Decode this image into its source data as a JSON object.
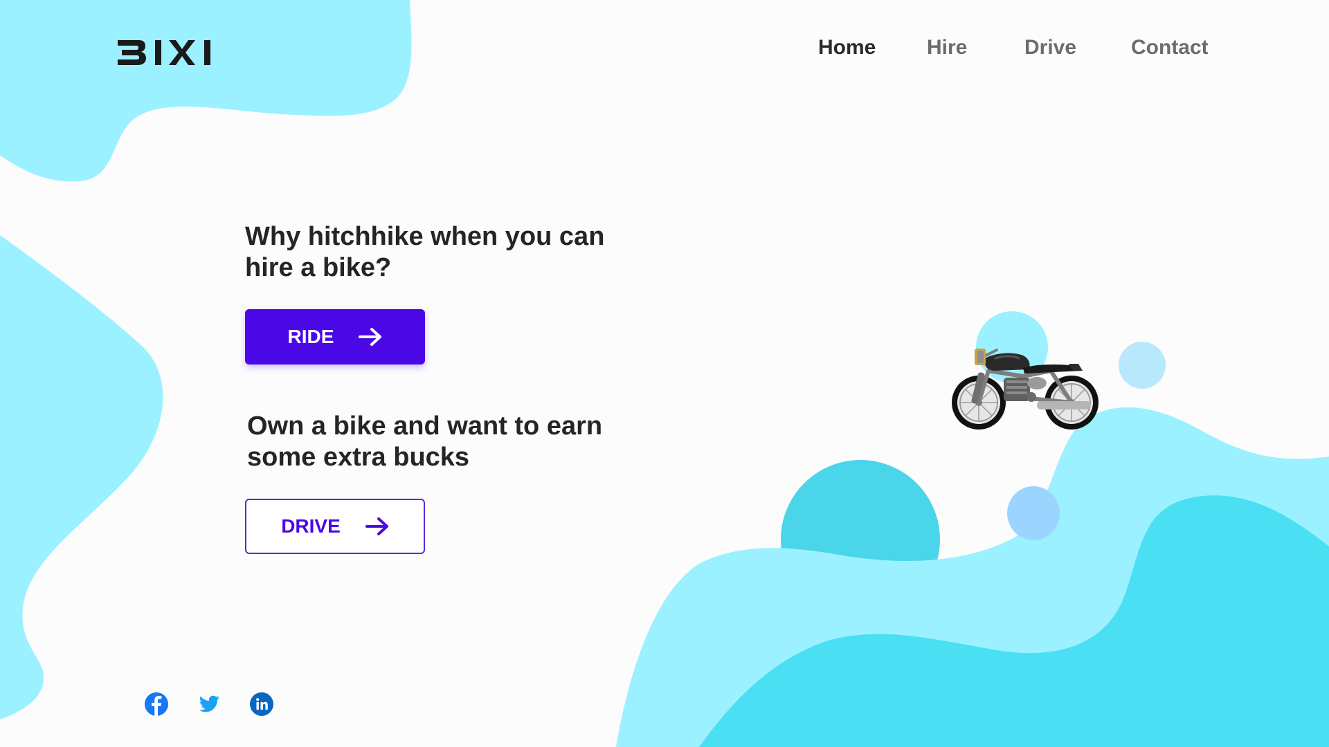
{
  "brand": {
    "logo_text": "BIXI"
  },
  "nav": {
    "items": [
      {
        "label": "Home",
        "active": true
      },
      {
        "label": "Hire",
        "active": false
      },
      {
        "label": "Drive",
        "active": false
      },
      {
        "label": "Contact",
        "active": false
      }
    ]
  },
  "hero": {
    "headline_1": "Why hitchhike when you can hire a bike?",
    "ride_button_label": "RIDE",
    "headline_2": "Own a bike and want to earn some extra bucks",
    "drive_button_label": "DRIVE",
    "button_icon": "arrow-right-icon",
    "illustration": "motorcycle-icon"
  },
  "social": [
    {
      "name": "facebook-icon",
      "color": "#1877f2"
    },
    {
      "name": "twitter-icon",
      "color": "#1da1f2"
    },
    {
      "name": "linkedin-icon",
      "color": "#0a66c2"
    }
  ],
  "colors": {
    "accent": "#4a08e6",
    "wave_light": "#9bf1ff",
    "wave_mid": "#4bdff3",
    "bubble": "#a9dcff",
    "text": "#252525",
    "nav_muted": "#6c6c6c"
  }
}
